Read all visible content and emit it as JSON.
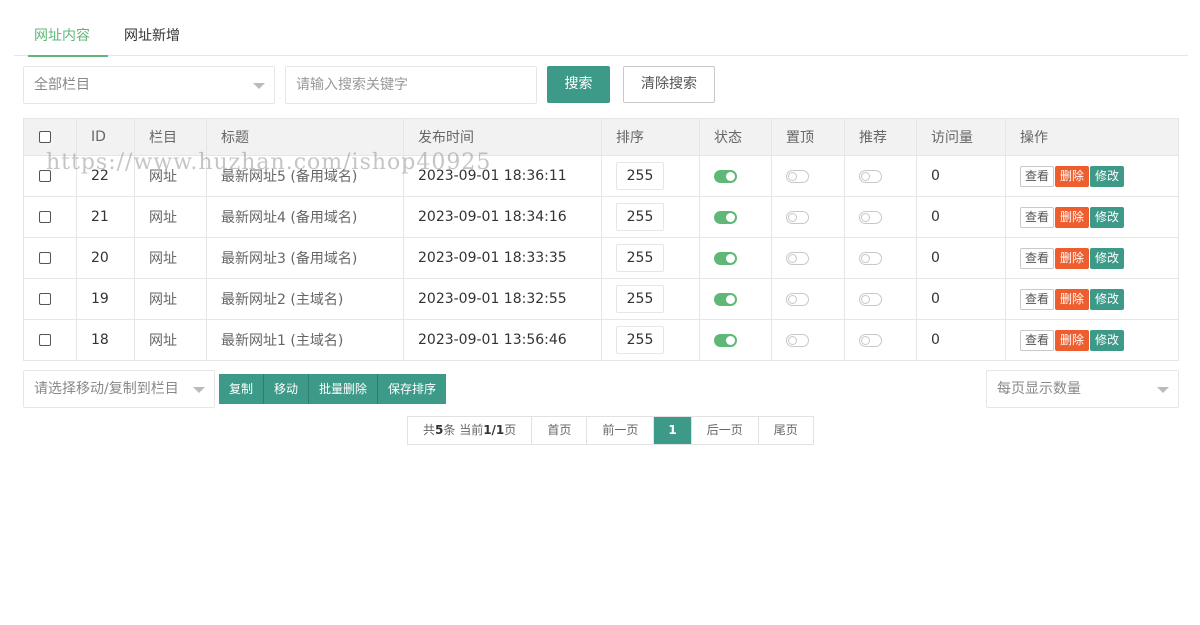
{
  "tabs": [
    {
      "label": "网址内容",
      "active": true
    },
    {
      "label": "网址新增",
      "active": false
    }
  ],
  "toolbar": {
    "category_select": "全部栏目",
    "search_placeholder": "请输入搜索关键字",
    "search_button": "搜索",
    "clear_button": "清除搜索"
  },
  "table": {
    "headers": [
      "ID",
      "栏目",
      "标题",
      "发布时间",
      "排序",
      "状态",
      "置顶",
      "推荐",
      "访问量",
      "操作"
    ],
    "rows": [
      {
        "id": "22",
        "category": "网址",
        "title": "最新网址5 (备用域名)",
        "time": "2023-09-01 18:36:11",
        "sort": "255",
        "status": true,
        "top": false,
        "recommend": false,
        "views": "0"
      },
      {
        "id": "21",
        "category": "网址",
        "title": "最新网址4 (备用域名)",
        "time": "2023-09-01 18:34:16",
        "sort": "255",
        "status": true,
        "top": false,
        "recommend": false,
        "views": "0"
      },
      {
        "id": "20",
        "category": "网址",
        "title": "最新网址3 (备用域名)",
        "time": "2023-09-01 18:33:35",
        "sort": "255",
        "status": true,
        "top": false,
        "recommend": false,
        "views": "0"
      },
      {
        "id": "19",
        "category": "网址",
        "title": "最新网址2 (主域名)",
        "time": "2023-09-01 18:32:55",
        "sort": "255",
        "status": true,
        "top": false,
        "recommend": false,
        "views": "0"
      },
      {
        "id": "18",
        "category": "网址",
        "title": "最新网址1 (主域名)",
        "time": "2023-09-01 13:56:46",
        "sort": "255",
        "status": true,
        "top": false,
        "recommend": false,
        "views": "0"
      }
    ],
    "ops": {
      "view": "查看",
      "delete": "删除",
      "edit": "修改"
    }
  },
  "batch": {
    "target_select": "请选择移动/复制到栏目",
    "buttons": [
      "复制",
      "移动",
      "批量删除",
      "保存排序"
    ],
    "per_page_select": "每页显示数量"
  },
  "pager": {
    "total_prefix": "共",
    "total_count": "5",
    "total_mid": "条 当前",
    "current_of": "1/1",
    "total_suffix": "页",
    "first": "首页",
    "prev": "前一页",
    "current": "1",
    "next": "后一页",
    "last": "尾页"
  },
  "watermark": "https://www.huzhan.com/ishop40925",
  "colors": {
    "accent": "#3d9988",
    "toggle_on": "#5fb878",
    "delete": "#ee5d2e",
    "tab_active": "#5fb878"
  }
}
